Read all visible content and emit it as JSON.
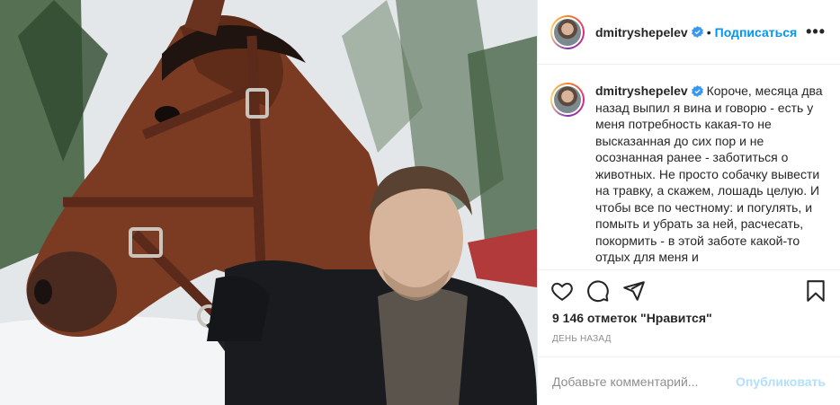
{
  "post": {
    "username": "dmitryshepelev",
    "follow_label": "Подписаться",
    "separator": "•",
    "more_label": "•••",
    "caption": "Короче, месяца два назад выпил я вина и говорю - есть у меня потребность какая-то не высказанная до сих пор и не осознанная ранее - заботиться о животных. Не просто собачку вывести на травку, а скажем, лошадь целую. И чтобы все по честному: и погулять, и помыть и убрать за ней, расчесать, покормить - в этой заботе какой-то отдых для меня и",
    "likes": "9 146 отметок \"Нравится\"",
    "time": "ДЕНЬ НАЗАД"
  },
  "comment": {
    "placeholder": "Добавьте комментарий...",
    "publish_label": "Опубликовать"
  },
  "icons": [
    "heart-icon",
    "comment-icon",
    "share-icon",
    "bookmark-icon",
    "verified-badge-icon",
    "more-options-icon"
  ],
  "colors": {
    "accent": "#0095f6",
    "publish_disabled": "#b2dffc",
    "muted": "#8e8e8e",
    "verified": "#3897f0"
  }
}
